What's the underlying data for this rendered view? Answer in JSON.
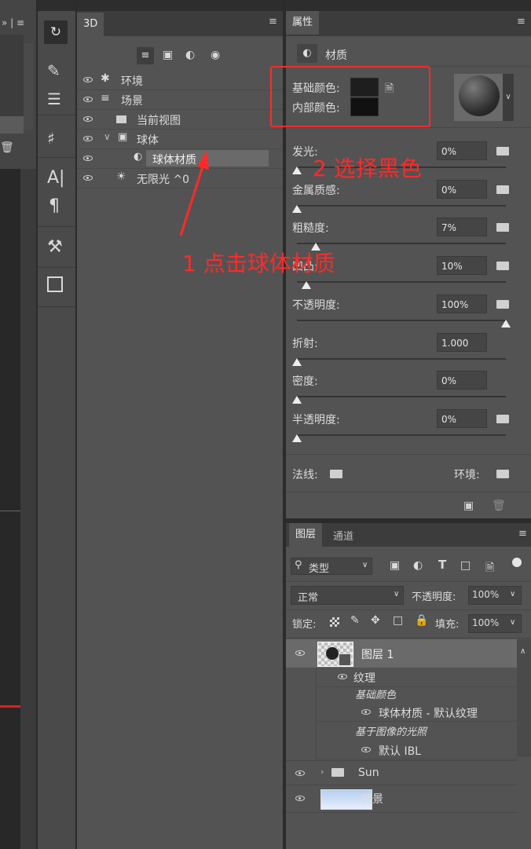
{
  "panel3d": {
    "tab": "3D",
    "rows": [
      {
        "label": "环境"
      },
      {
        "label": "场景"
      },
      {
        "label": "当前视图"
      },
      {
        "label": "球体"
      },
      {
        "label": "球体材质"
      },
      {
        "label": "无限光 ^0"
      }
    ]
  },
  "props": {
    "tab": "属性",
    "header": "材质",
    "base_color_label": "基础颜色:",
    "inner_color_label": "内部颜色:",
    "base_color": "#1e1e1e",
    "inner_color": "#111111",
    "params": [
      {
        "label": "发光:",
        "value": "0%"
      },
      {
        "label": "金属质感:",
        "value": "0%"
      },
      {
        "label": "粗糙度:",
        "value": "7%"
      },
      {
        "label": "凹凸:",
        "value": "10%"
      },
      {
        "label": "不透明度:",
        "value": "100%"
      },
      {
        "label": "折射:",
        "value": "1.000"
      },
      {
        "label": "密度:",
        "value": "0%"
      },
      {
        "label": "半透明度:",
        "value": "0%"
      }
    ],
    "normal_label": "法线:",
    "env_label": "环境:"
  },
  "layers": {
    "tab_layers": "图层",
    "tab_channels": "通道",
    "filter": "类型",
    "blend_mode": "正常",
    "opacity_label": "不透明度:",
    "opacity_value": "100%",
    "lock_label": "锁定:",
    "fill_label": "填充:",
    "fill_value": "100%",
    "layer1": "图层 1",
    "texture": "纹理",
    "base_color": "基础颜色",
    "sphere_tex": "球体材质 - 默认纹理",
    "ibl": "基于图像的光照",
    "default_ibl": "默认 IBL",
    "sun": "Sun",
    "background": "背景"
  },
  "annotations": {
    "step1": "1 点击球体材质",
    "step2": "2 选择黑色"
  }
}
